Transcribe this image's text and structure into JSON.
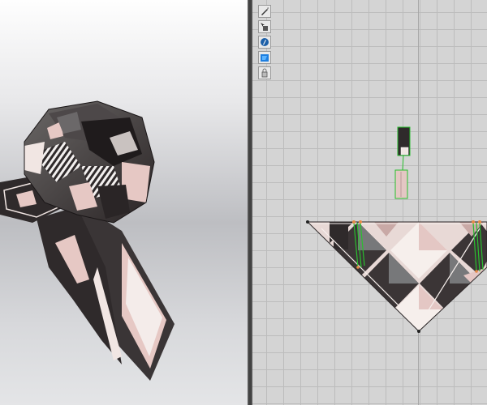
{
  "app": {
    "panels": [
      "3d-viewport",
      "2d-pattern-window"
    ]
  },
  "toolbar": {
    "tools": [
      {
        "name": "edit-pattern-tool-icon"
      },
      {
        "name": "transform-pattern-tool-icon"
      },
      {
        "name": "sewing-tool-icon"
      },
      {
        "name": "texture-tool-icon"
      },
      {
        "name": "pin-tool-icon"
      }
    ]
  },
  "colors": {
    "background_2d": "#d4d4d4",
    "grid_line": "#bcbcbc",
    "fabric_dark": "#3b3536",
    "fabric_gray": "#77787a",
    "fabric_pink": "#e4c7c4",
    "fabric_white": "#f6efec",
    "seam_green": "#29c02e",
    "point_orange": "#e58a46"
  }
}
